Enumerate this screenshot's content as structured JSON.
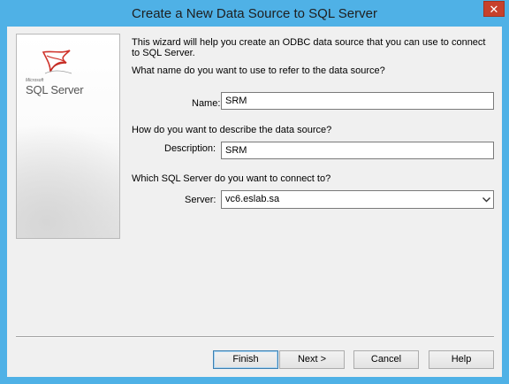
{
  "window": {
    "title": "Create a New Data Source to SQL Server",
    "close_label": "✕"
  },
  "banner": {
    "brand_small": "Microsoft",
    "brand": "SQL Server",
    "logo_icon": "sql-server-logo-icon"
  },
  "intro": "This wizard will help you create an ODBC data source that you can use to connect to SQL Server.",
  "name_section": {
    "question": "What name do you want to use to refer to the data source?",
    "label": "Name:",
    "value": "SRM"
  },
  "description_section": {
    "question": "How do you want to describe the data source?",
    "label": "Description:",
    "value": "SRM"
  },
  "server_section": {
    "question": "Which SQL Server do you want to connect to?",
    "label": "Server:",
    "value": "vc6.eslab.sa",
    "dropdown_icon": "chevron-down-icon"
  },
  "buttons": {
    "finish": "Finish",
    "next": "Next >",
    "cancel": "Cancel",
    "help": "Help"
  },
  "colors": {
    "frame": "#4fb1e6",
    "client": "#f0f0f0",
    "close": "#c7412c",
    "logo_red": "#d0342c"
  }
}
